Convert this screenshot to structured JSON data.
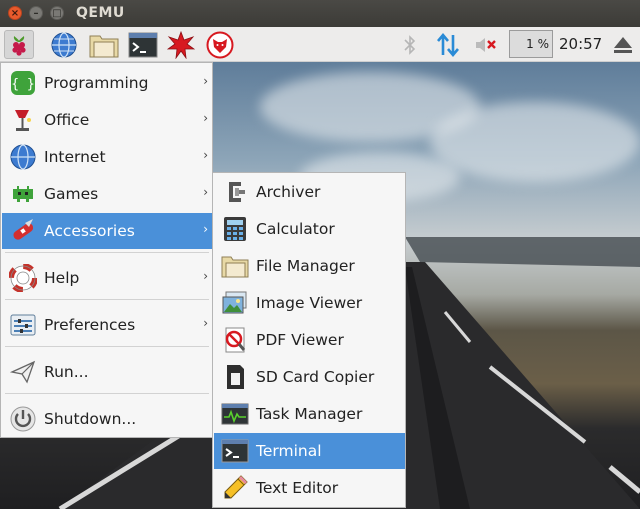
{
  "window": {
    "title": "QEMU",
    "close_glyph": "×",
    "min_glyph": "–",
    "max_glyph": "□"
  },
  "panel": {
    "launchers": [
      "raspberry-menu-icon",
      "web-browser-icon",
      "file-manager-icon",
      "terminal-icon",
      "mathematica-icon",
      "wolfram-icon"
    ],
    "tray": [
      "bluetooth-icon",
      "network-transfer-icon",
      "volume-muted-icon"
    ],
    "cpu_usage": "1 %",
    "clock": "20:57",
    "eject_icon": "eject-icon"
  },
  "menu": {
    "items": [
      {
        "label": "Programming",
        "icon": "programming-icon",
        "has_submenu": true
      },
      {
        "label": "Office",
        "icon": "office-icon",
        "has_submenu": true
      },
      {
        "label": "Internet",
        "icon": "internet-icon",
        "has_submenu": true
      },
      {
        "label": "Games",
        "icon": "games-icon",
        "has_submenu": true
      },
      {
        "label": "Accessories",
        "icon": "accessories-icon",
        "has_submenu": true,
        "active": true
      },
      {
        "label": "Help",
        "icon": "help-icon",
        "has_submenu": true
      },
      {
        "label": "Preferences",
        "icon": "preferences-icon",
        "has_submenu": true
      },
      {
        "label": "Run...",
        "icon": "run-icon",
        "has_submenu": false
      },
      {
        "label": "Shutdown...",
        "icon": "shutdown-icon",
        "has_submenu": false
      }
    ],
    "arrow_glyph": "›"
  },
  "submenu": {
    "items": [
      {
        "label": "Archiver",
        "icon": "archiver-icon"
      },
      {
        "label": "Calculator",
        "icon": "calculator-icon"
      },
      {
        "label": "File Manager",
        "icon": "file-manager-icon"
      },
      {
        "label": "Image Viewer",
        "icon": "image-viewer-icon"
      },
      {
        "label": "PDF Viewer",
        "icon": "pdf-viewer-icon"
      },
      {
        "label": "SD Card Copier",
        "icon": "sd-card-copier-icon"
      },
      {
        "label": "Task Manager",
        "icon": "task-manager-icon"
      },
      {
        "label": "Terminal",
        "icon": "terminal-icon",
        "active": true
      },
      {
        "label": "Text Editor",
        "icon": "text-editor-icon"
      }
    ]
  },
  "colors": {
    "accent": "#4a90d9",
    "menu_bg": "#f6f6f6",
    "panel_bg": "#edeceb"
  }
}
